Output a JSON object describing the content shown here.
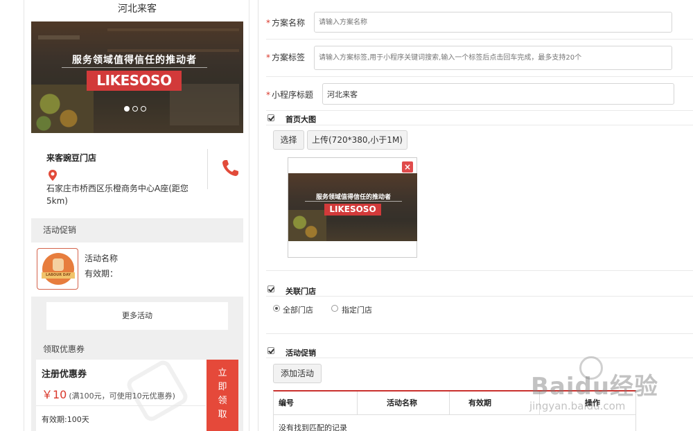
{
  "preview": {
    "title": "河北来客",
    "banner": {
      "slogan": "服务领域值得信任的推动者",
      "logo": "LIKESOSO",
      "slides": 3,
      "active_slide": 1
    },
    "store": {
      "name": "来客豌豆门店",
      "address": "石家庄市桥西区乐橙商务中心A座(距您5km)",
      "icons": {
        "location": "location-pin-icon",
        "phone": "phone-icon"
      }
    },
    "promotions": {
      "header": "活动促销",
      "item": {
        "name": "活动名称",
        "validity": "有效期：",
        "image_text": "LABOUR DAY"
      },
      "more_label": "更多活动"
    },
    "coupons": {
      "header": "领取优惠券",
      "item": {
        "title": "注册优惠券",
        "amount": "￥10",
        "condition": "(满100元，可使用10元优惠券)",
        "validity": "有效期:100天",
        "claim": [
          "立",
          "即",
          "领",
          "取"
        ]
      }
    }
  },
  "form": {
    "plan_name": {
      "required_mark": "*",
      "label": "方案名称",
      "placeholder": "请输入方案名称",
      "value": ""
    },
    "plan_tags": {
      "required_mark": "*",
      "label": "方案标签",
      "placeholder": "请输入方案标签,用于小程序关键词搜索,输入一个标签后点击回车完成，最多支持20个",
      "value": ""
    },
    "mini_title": {
      "required_mark": "*",
      "label": "小程序标题",
      "value": "河北来客"
    },
    "home_image": {
      "label": "首页大图",
      "checked": true,
      "select_label": "选择",
      "upload_label": "上传(720*380,小于1M)",
      "remove_label": "×",
      "preview_slogan": "服务领域值得信任的推动者",
      "preview_logo": "LIKESOSO"
    },
    "linked_stores": {
      "label": "关联门店",
      "checked": true,
      "options": [
        {
          "label": "全部门店",
          "selected": true
        },
        {
          "label": "指定门店",
          "selected": false
        }
      ]
    },
    "activity_promo": {
      "label": "活动促销",
      "checked": true,
      "add_label": "添加活动",
      "table": {
        "columns": [
          "编号",
          "活动名称",
          "有效期",
          "操作"
        ],
        "empty_text": "没有找到匹配的记录"
      }
    }
  },
  "watermark": {
    "brand": "Baidu经验",
    "url": "jingyan.baidu.com"
  },
  "colors": {
    "accent_red": "#d9372a",
    "claim_red": "#e5493a",
    "logo_red": "#d23a3a"
  }
}
